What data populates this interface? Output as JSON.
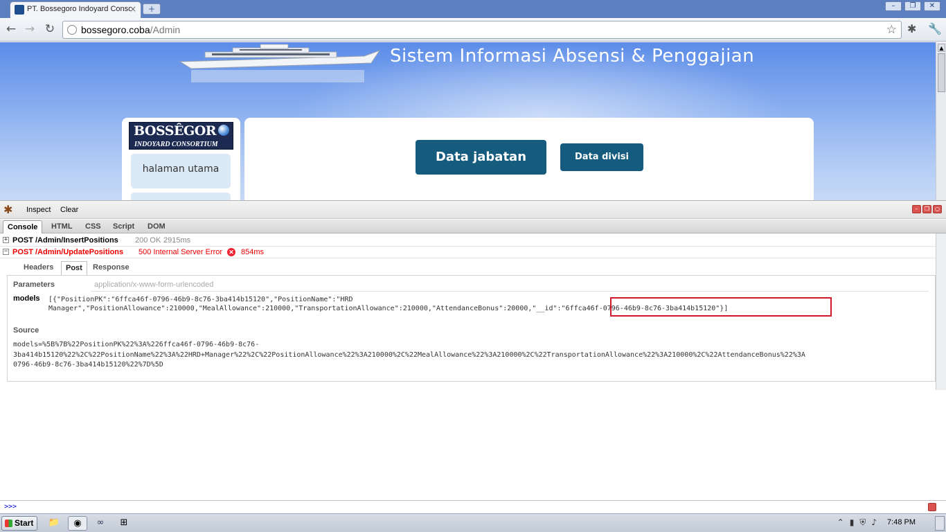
{
  "browser": {
    "tab_title": "PT. Bossegoro Indoyard Consortium",
    "url_host": "bossegoro.coba",
    "url_path": "/Admin"
  },
  "page": {
    "site_title": "Sistem Informasi Absensi & Penggajian",
    "logo_line1": "BOSSÊGOR",
    "logo_line2": "INDOYARD CONSORTIUM",
    "sidebar_items": [
      "halaman utama",
      ""
    ],
    "btn_jabatan": "Data jabatan",
    "btn_divisi": "Data divisi"
  },
  "firebug": {
    "toolbar": {
      "inspect": "Inspect",
      "clear": "Clear"
    },
    "tabs": [
      "Console",
      "HTML",
      "CSS",
      "Script",
      "DOM"
    ],
    "active_tab": "Console",
    "requests": [
      {
        "toggle": "+",
        "label": "POST /Admin/InsertPositions",
        "status": "200 OK",
        "time": "2915ms",
        "error": false
      },
      {
        "toggle": "−",
        "label": "POST /Admin/UpdatePositions",
        "status": "500 Internal Server Error",
        "time": "854ms",
        "error": true
      }
    ],
    "subtabs": [
      "Headers",
      "Post",
      "Response"
    ],
    "active_subtab": "Post",
    "parameters_label": "Parameters",
    "content_type": "application/x-www-form-urlencoded",
    "param_name": "models",
    "param_value_line1": "[{\"PositionPK\":\"6ffca46f-0796-46b9-8c76-3ba414b15120\",\"PositionName\":\"HRD",
    "param_value_line2": "Manager\",\"PositionAllowance\":210000,\"MealAllowance\":210000,\"TransportationAllowance\":210000,\"AttendanceBonus\":20000,\"__id\":\"6ffca46f-0796-46b9-8c76-3ba414b15120\"}]",
    "source_label": "Source",
    "source_line1": "models=%5B%7B%22PositionPK%22%3A%226ffca46f-0796-46b9-8c76-",
    "source_line2": "3ba414b15120%22%2C%22PositionName%22%3A%22HRD+Manager%22%2C%22PositionAllowance%22%3A210000%2C%22MealAllowance%22%3A210000%2C%22TransportationAllowance%22%3A210000%2C%22AttendanceBonus%22%3A",
    "source_line3": "0796-46b9-8c76-3ba414b15120%22%7D%5D",
    "prompt": ">>>"
  },
  "taskbar": {
    "start": "Start",
    "clock": "7:48 PM"
  },
  "colors": {
    "accent_button": "#145b7e",
    "error_red": "#ee0000",
    "highlight_box": "#d0182a"
  }
}
